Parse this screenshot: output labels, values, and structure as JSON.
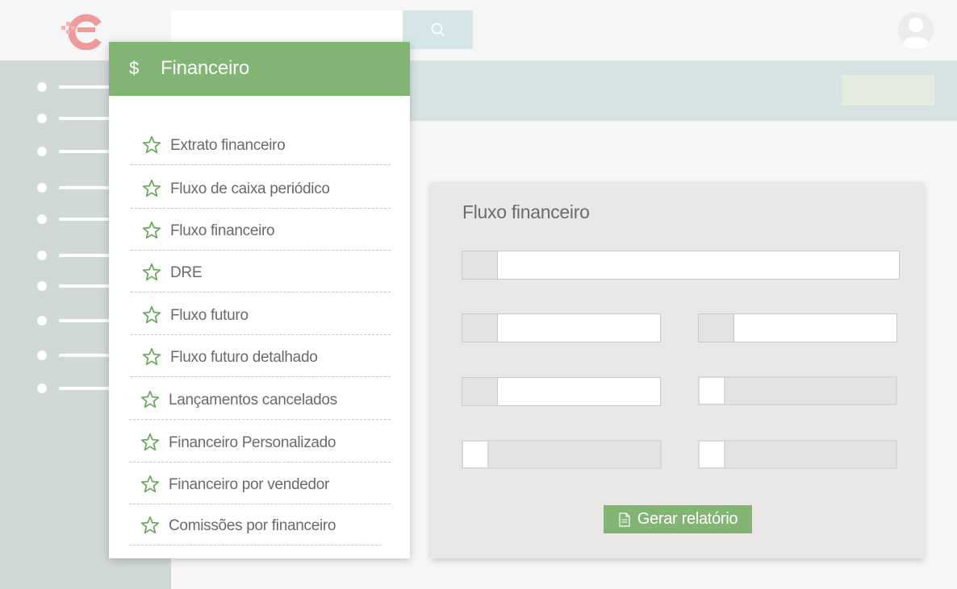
{
  "colors": {
    "accent_green": "#82b474",
    "sidebar_bg": "#d1d8d8",
    "band_bg": "#d7e2e3",
    "logo_red": "#e88a8a"
  },
  "header": {
    "search_placeholder": "",
    "search_icon": "search-icon",
    "avatar_icon": "user-avatar-icon"
  },
  "menu": {
    "icon": "$",
    "title": "Financeiro",
    "items": [
      {
        "label": "Extrato financeiro",
        "icon": "star-icon"
      },
      {
        "label": "Fluxo de caixa periódico",
        "icon": "star-icon"
      },
      {
        "label": "Fluxo financeiro",
        "icon": "star-icon"
      },
      {
        "label": "DRE",
        "icon": "star-icon"
      },
      {
        "label": "Fluxo futuro",
        "icon": "star-icon"
      },
      {
        "label": "Fluxo futuro detalhado",
        "icon": "star-icon"
      },
      {
        "label": "Lançamentos cancelados",
        "icon": "star-icon"
      },
      {
        "label": "Financeiro Personalizado",
        "icon": "star-icon"
      },
      {
        "label": "Financeiro por vendedor",
        "icon": "star-icon"
      },
      {
        "label": "Comissões por financeiro",
        "icon": "star-icon"
      }
    ]
  },
  "report": {
    "title": "Fluxo financeiro",
    "generate_label": "Gerar relatório"
  }
}
